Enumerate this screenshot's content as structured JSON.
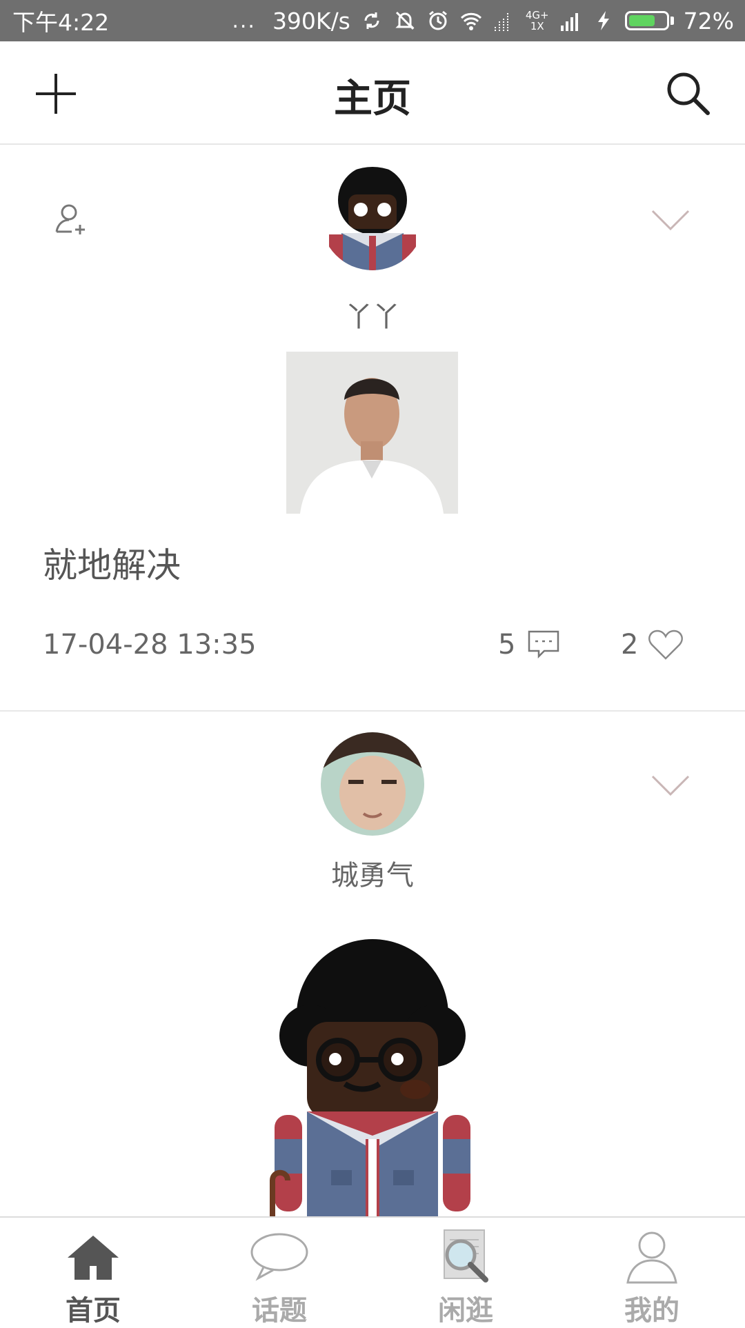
{
  "status_bar": {
    "time": "下午4:22",
    "dots": "...",
    "speed": "390K/s",
    "network_top": "4G+",
    "network_bottom": "1X",
    "battery_percent": "72%",
    "battery_level": 0.72
  },
  "header": {
    "title": "主页",
    "add_icon": "plus-icon",
    "search_icon": "search-icon"
  },
  "posts": [
    {
      "username": "丫丫",
      "text": "就地解决",
      "date": "17-04-28 13:35",
      "comment_count": "5",
      "like_count": "2",
      "icons": [
        "follow-user-icon",
        "chevron-down-icon",
        "comment-icon",
        "heart-icon"
      ]
    },
    {
      "username": "城勇气",
      "icons": [
        "chevron-down-icon"
      ]
    }
  ],
  "tabs": [
    {
      "label": "首页",
      "icon": "home-icon",
      "active": true
    },
    {
      "label": "话题",
      "icon": "speech-bubble-icon",
      "active": false
    },
    {
      "label": "闲逛",
      "icon": "magnifier-document-icon",
      "active": false
    },
    {
      "label": "我的",
      "icon": "person-icon",
      "active": false
    }
  ],
  "colors": {
    "status_bar": "#6f6f6f",
    "battery_fill": "#5fd45f",
    "tab_active": "#555555",
    "tab_inactive": "#aaaaaa"
  }
}
